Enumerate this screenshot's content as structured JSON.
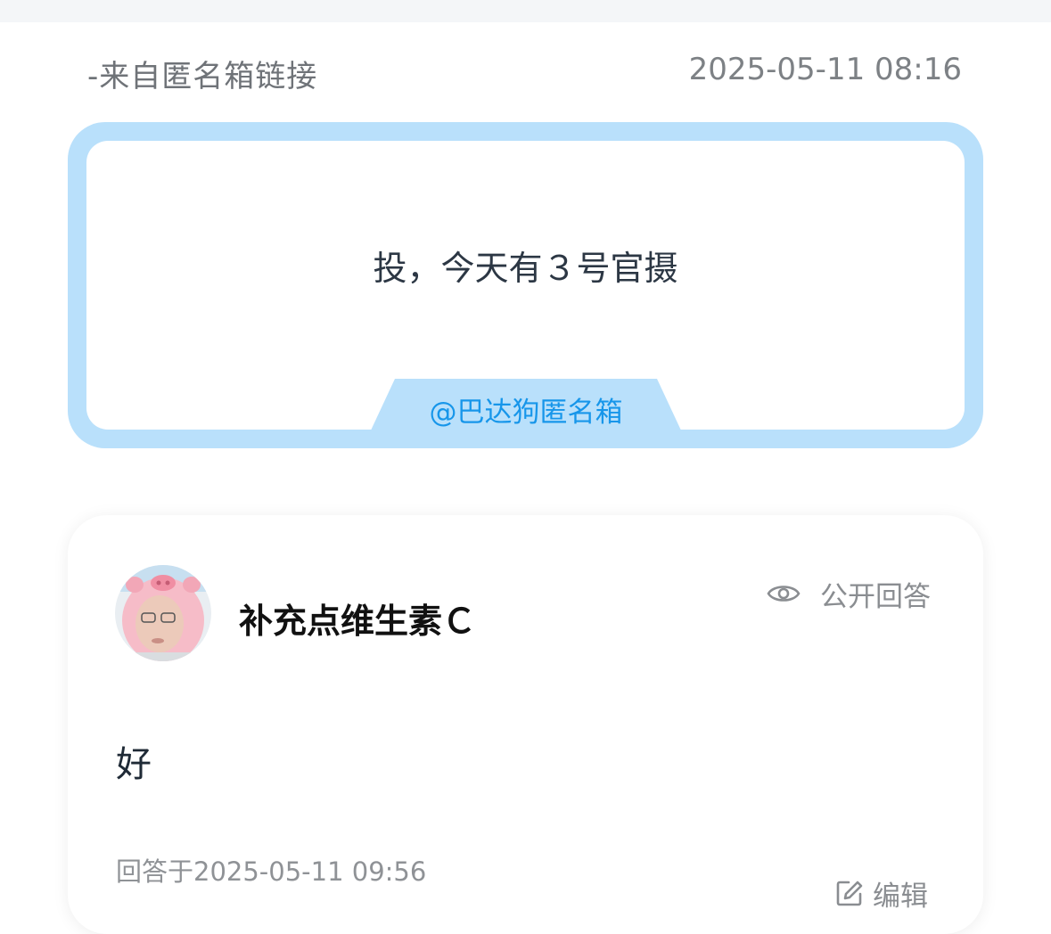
{
  "message": {
    "source": "-来自匿名箱链接",
    "timestamp": "2025-05-11 08:16",
    "question_text": "投，今天有３号官摄",
    "box_tag": "@巴达狗匿名箱"
  },
  "answer": {
    "username": "补充点维生素Ｃ",
    "visibility_label": "公开回答",
    "visibility_icon": "eye-icon",
    "answer_text": "好",
    "answered_at": "回答于2025-05-11 09:56",
    "edit_label": "编辑",
    "edit_icon": "edit-icon"
  },
  "colors": {
    "card_border": "#b9e0fb",
    "tag_text": "#1796ea"
  }
}
